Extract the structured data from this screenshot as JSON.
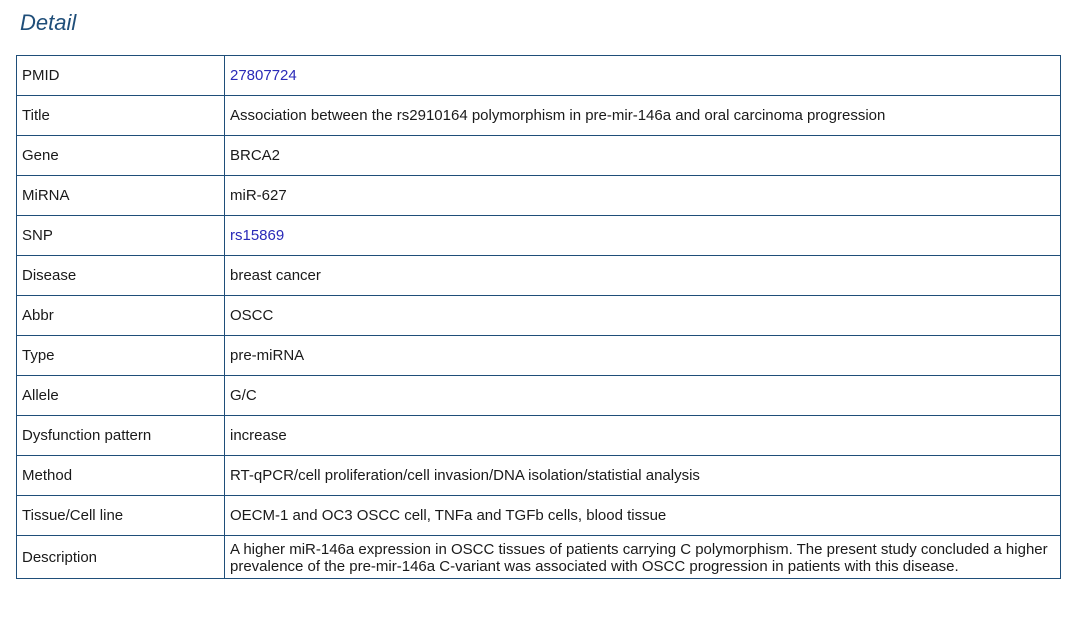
{
  "page": {
    "title": "Detail"
  },
  "colors": {
    "title": "#1f4e79",
    "border": "#1f4e79",
    "link": "#2a2ab8",
    "text": "#1a1a1a"
  },
  "rows": [
    {
      "label": "PMID",
      "value": "27807724"
    },
    {
      "label": "Title",
      "value": "Association between the rs2910164 polymorphism in pre-mir-146a and oral carcinoma progression"
    },
    {
      "label": "Gene",
      "value": "BRCA2"
    },
    {
      "label": "MiRNA",
      "value": "miR-627"
    },
    {
      "label": "SNP",
      "value": "rs15869"
    },
    {
      "label": "Disease",
      "value": "breast cancer"
    },
    {
      "label": "Abbr",
      "value": "OSCC"
    },
    {
      "label": "Type",
      "value": "pre-miRNA"
    },
    {
      "label": "Allele",
      "value": "G/C"
    },
    {
      "label": "Dysfunction pattern",
      "value": "increase"
    },
    {
      "label": "Method",
      "value": "RT-qPCR/cell proliferation/cell invasion/DNA isolation/statistial analysis"
    },
    {
      "label": "Tissue/Cell line",
      "value": "OECM-1 and OC3 OSCC cell, TNFa and TGFb cells, blood tissue"
    },
    {
      "label": "Description",
      "value": "A higher miR-146a expression in OSCC tissues of patients carrying C polymorphism. The present study concluded a higher prevalence of the pre-mir-146a C-variant was associated with OSCC progression in patients with this disease."
    }
  ]
}
